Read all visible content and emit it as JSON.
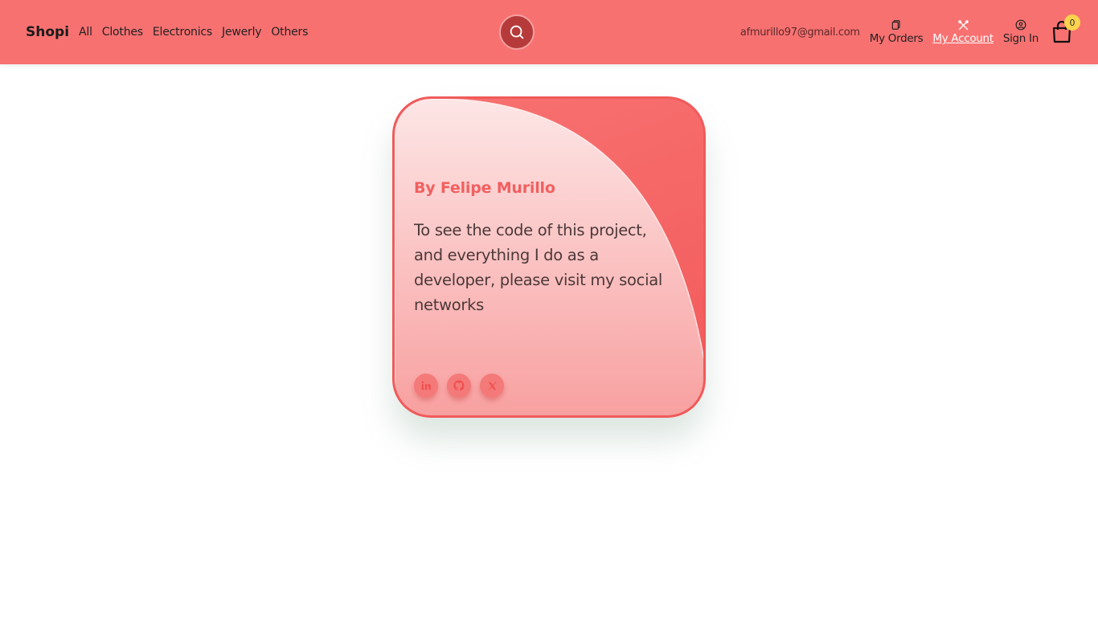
{
  "navbar": {
    "brand": "Shopi",
    "categories": [
      "All",
      "Clothes",
      "Electronics",
      "Jewerly",
      "Others"
    ],
    "email": "afmurillo97@gmail.com",
    "my_orders": "My Orders",
    "my_account": "My Account",
    "sign_in": "Sign In",
    "cart_count": "0"
  },
  "card": {
    "author": "By Felipe Murillo",
    "text": "To see the code of this project, and everything I do as a developer, please visit my social networks",
    "socials": [
      "linkedin-icon",
      "github-icon",
      "x-icon"
    ]
  },
  "colors": {
    "accent": "#f87171",
    "search_button": "#b73a3a",
    "badge": "#fcd34d"
  }
}
